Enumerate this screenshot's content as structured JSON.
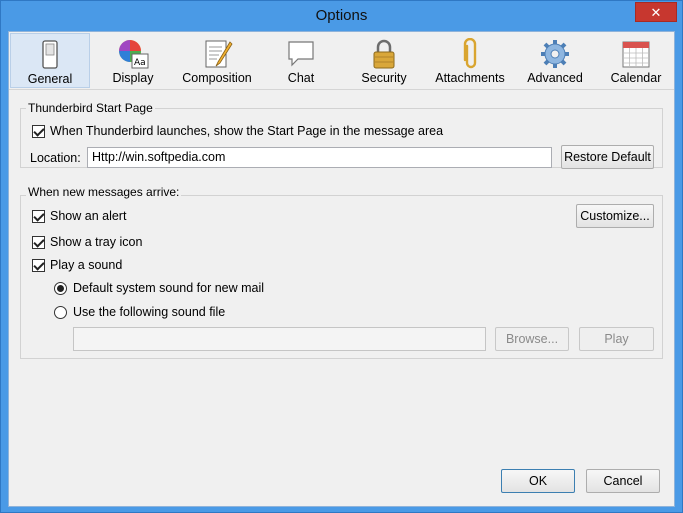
{
  "window": {
    "title": "Options",
    "close_glyph": "✕"
  },
  "toolbar": {
    "tabs": [
      {
        "label": "General",
        "icon": "switch-icon",
        "selected": true
      },
      {
        "label": "Display",
        "icon": "color-wheel-icon"
      },
      {
        "label": "Composition",
        "icon": "pencil-paper-icon"
      },
      {
        "label": "Chat",
        "icon": "speech-bubble-icon"
      },
      {
        "label": "Security",
        "icon": "padlock-icon"
      },
      {
        "label": "Attachments",
        "icon": "paperclip-icon"
      },
      {
        "label": "Advanced",
        "icon": "gear-icon"
      },
      {
        "label": "Calendar",
        "icon": "calendar-icon"
      }
    ]
  },
  "start_page": {
    "legend": "Thunderbird Start Page",
    "show_start_page_label": "When Thunderbird launches, show the Start Page in the message area",
    "show_start_page_checked": true,
    "location_label": "Location:",
    "location_value": "Http://win.softpedia.com",
    "restore_default_label": "Restore Default"
  },
  "new_messages": {
    "legend": "When new messages arrive:",
    "show_alert_label": "Show an alert",
    "show_alert_checked": true,
    "customize_label": "Customize...",
    "tray_icon_label": "Show a tray icon",
    "tray_icon_checked": true,
    "play_sound_label": "Play a sound",
    "play_sound_checked": true,
    "default_sound_label": "Default system sound for new mail",
    "default_sound_selected": true,
    "custom_sound_label": "Use the following sound file",
    "sound_file_value": "",
    "browse_label": "Browse...",
    "play_label": "Play"
  },
  "footer": {
    "ok_label": "OK",
    "cancel_label": "Cancel"
  },
  "colors": {
    "titlebar": "#4a9ae6",
    "selected_tab": "#dbe7f5",
    "close": "#c7372f"
  }
}
